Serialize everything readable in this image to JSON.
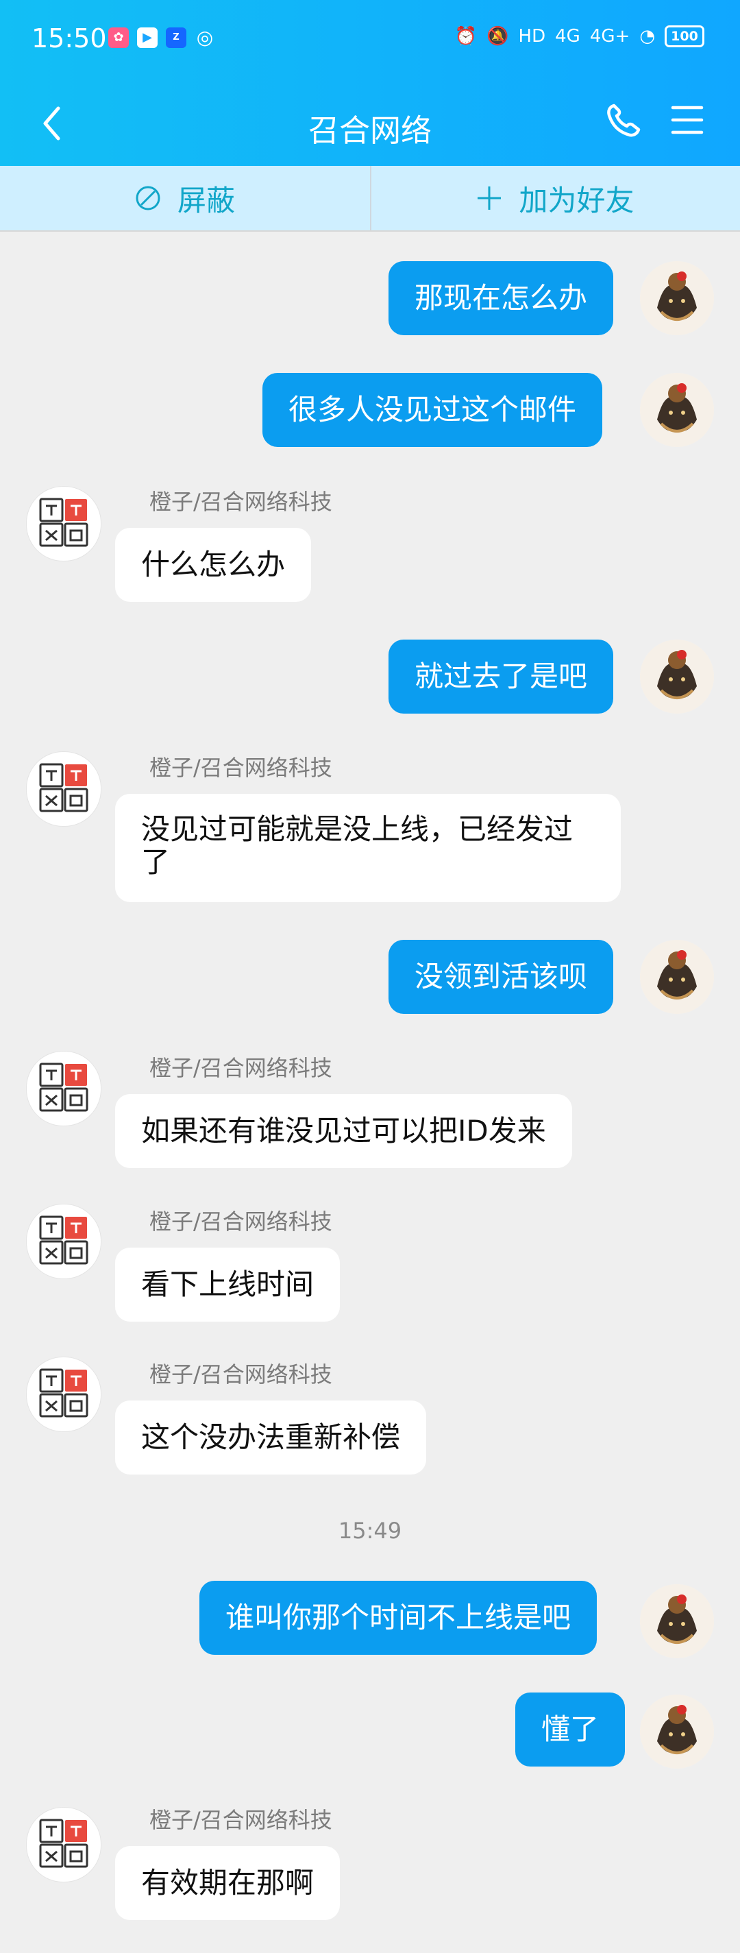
{
  "status_bar": {
    "time": "15:50",
    "battery": "100",
    "network_1": "4G",
    "network_2": "4G+",
    "hd": "HD"
  },
  "header": {
    "title": "召合网络"
  },
  "actions": {
    "block": "屏蔽",
    "add_friend": "加为好友"
  },
  "chat": {
    "timestamp": "15:49",
    "messages": [
      {
        "text": "那现在怎么办"
      },
      {
        "text": "很多人没见过这个邮件"
      },
      {
        "sender": "橙子/召合网络科技",
        "text": "什么怎么办"
      },
      {
        "text": "就过去了是吧"
      },
      {
        "sender": "橙子/召合网络科技",
        "text": "没见过可能就是没上线，已经发过了"
      },
      {
        "text": "没领到活该呗"
      },
      {
        "sender": "橙子/召合网络科技",
        "text": "如果还有谁没见过可以把ID发来"
      },
      {
        "sender": "橙子/召合网络科技",
        "text": "看下上线时间"
      },
      {
        "sender": "橙子/召合网络科技",
        "text": "这个没办法重新补偿"
      },
      {
        "text": "谁叫你那个时间不上线是吧"
      },
      {
        "text": "懂了"
      },
      {
        "sender": "橙子/召合网络科技",
        "text": "有效期在那啊"
      }
    ]
  },
  "colors": {
    "primary": "#0b9df0",
    "action_text": "#11a6c9",
    "action_bg": "#cfefff"
  }
}
